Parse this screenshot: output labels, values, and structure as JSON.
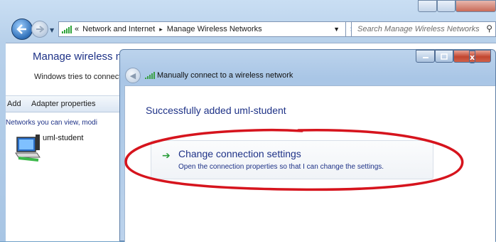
{
  "explorer": {
    "breadcrumb_prefix": "«",
    "breadcrumb_1": "Network and Internet",
    "breadcrumb_sep": "▸",
    "breadcrumb_2": "Manage Wireless Networks",
    "search_placeholder": "Search Manage Wireless Networks",
    "title": "Manage wireless ne",
    "description": "Windows tries to connect",
    "toolbar": {
      "add": "Add",
      "adapter_properties": "Adapter properties"
    },
    "list_heading": "Networks you can view, modi",
    "networks": [
      {
        "name": "uml-student"
      }
    ]
  },
  "dialog": {
    "close_glyph": "x",
    "heading": "Manually connect to a wireless network",
    "success_message": "Successfully added uml-student",
    "command_link": {
      "title": "Change connection settings",
      "description": "Open the connection properties so that I can change the settings."
    }
  },
  "colors": {
    "link_blue": "#1e3287",
    "annotation_red": "#d6141d",
    "arrow_green": "#2a9d3a"
  },
  "icons": {
    "back": "back-arrow-icon",
    "forward": "forward-arrow-icon",
    "wifi": "wifi-signal-icon",
    "refresh": "refresh-icon",
    "search": "search-icon",
    "network": "wireless-network-icon",
    "command_arrow": "green-arrow-icon"
  }
}
